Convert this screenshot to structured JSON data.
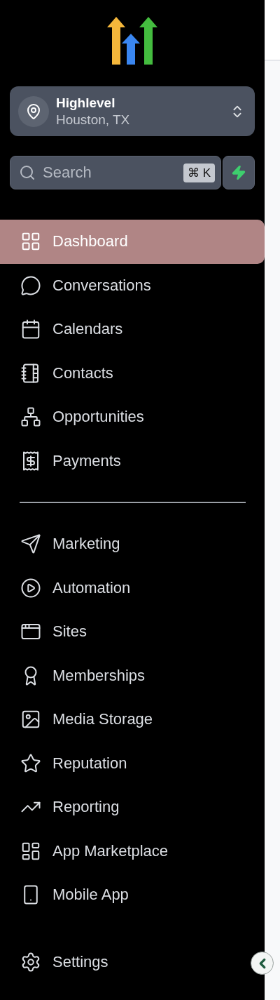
{
  "location": {
    "name": "Highlevel",
    "address": "Houston, TX"
  },
  "search": {
    "placeholder": "Search",
    "shortcut": "⌘ K"
  },
  "nav_groups": [
    {
      "items": [
        {
          "label": "Dashboard",
          "selected": true
        },
        {
          "label": "Conversations",
          "selected": false
        },
        {
          "label": "Calendars",
          "selected": false
        },
        {
          "label": "Contacts",
          "selected": false
        },
        {
          "label": "Opportunities",
          "selected": false
        },
        {
          "label": "Payments",
          "selected": false
        }
      ]
    },
    {
      "items": [
        {
          "label": "Marketing",
          "selected": false
        },
        {
          "label": "Automation",
          "selected": false
        },
        {
          "label": "Sites",
          "selected": false
        },
        {
          "label": "Memberships",
          "selected": false
        },
        {
          "label": "Media Storage",
          "selected": false
        },
        {
          "label": "Reputation",
          "selected": false
        },
        {
          "label": "Reporting",
          "selected": false
        },
        {
          "label": "App Marketplace",
          "selected": false
        },
        {
          "label": "Mobile App",
          "selected": false
        }
      ]
    }
  ],
  "settings": {
    "label": "Settings",
    "selected": false
  }
}
